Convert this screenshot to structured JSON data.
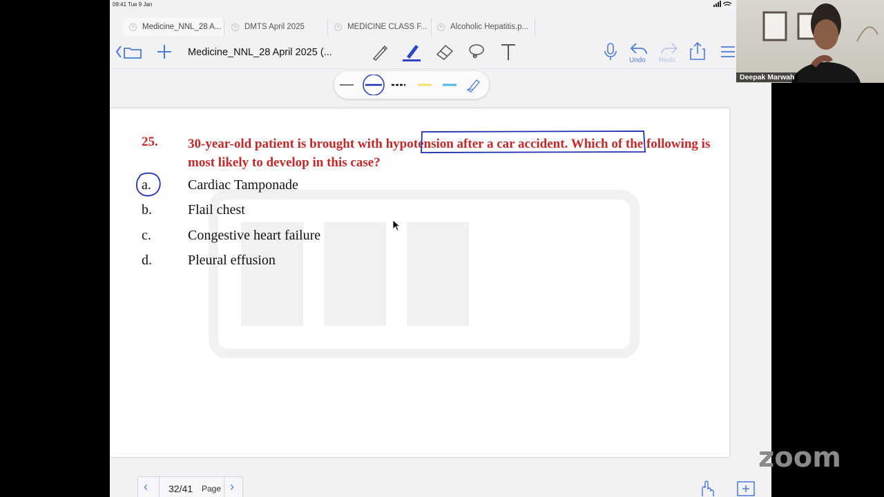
{
  "status_bar": {
    "time": "09:41  Tue 9 Jan"
  },
  "tabs": [
    {
      "label": "Medicine_NNL_28 A..."
    },
    {
      "label": "DMTS April 2025"
    },
    {
      "label": "MEDICINE CLASS F..."
    },
    {
      "label": "Alcoholic Hepatitis.p..."
    }
  ],
  "toolbar": {
    "doc_title": "Medicine_NNL_28 April 2025 (...",
    "undo_label": "Undo",
    "redo_label": "Redo"
  },
  "question": {
    "number": "25.",
    "text_before": "30-year-old patient is brought with ",
    "highlight": "hypotension after a car accident.",
    "text_after": " Which of the following is most likely to develop in this case?",
    "options": [
      {
        "letter": "a.",
        "text": "Cardiac Tamponade",
        "circled": true
      },
      {
        "letter": "b.",
        "text": "Flail chest"
      },
      {
        "letter": "c.",
        "text": "Congestive heart failure"
      },
      {
        "letter": "d.",
        "text": "Pleural effusion"
      }
    ]
  },
  "pager": {
    "count": "32/41",
    "word": "Page",
    "prev": "‹",
    "next": "›"
  },
  "participant": {
    "name": "Deepak Marwah"
  },
  "zoom_logo": "zoom",
  "colors": {
    "accent": "#4a7bd6",
    "question_red": "#c62828",
    "annotation_blue": "#1c2fb0"
  }
}
